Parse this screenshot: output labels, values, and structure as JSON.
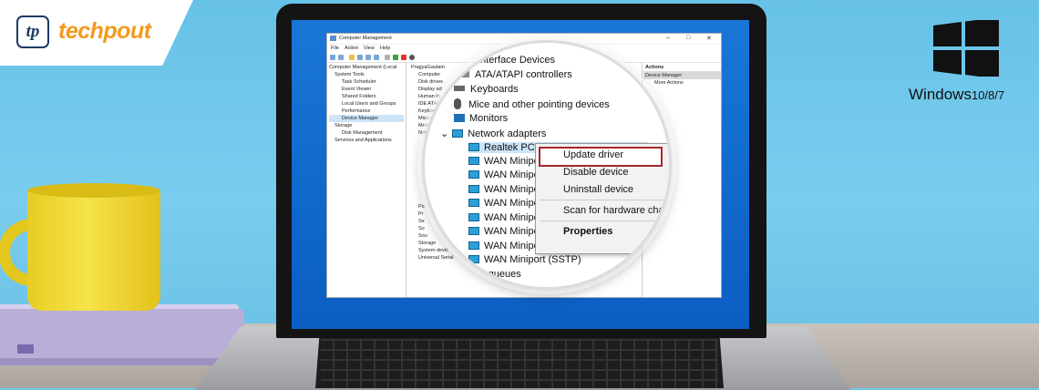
{
  "brand": {
    "logo_mark": "tp",
    "logo_text": "techpout"
  },
  "os_badge": {
    "name": "Windows",
    "versions": "10/8/7",
    "icon": "windows-logo-icon"
  },
  "window": {
    "title": "Computer Management",
    "controls": [
      "–",
      "□",
      "✕"
    ],
    "menu": [
      "File",
      "Action",
      "View",
      "Help"
    ],
    "left_tree": [
      "Computer Management (Local",
      "System Tools",
      "Task Scheduler",
      "Event Viewer",
      "Shared Folders",
      "Local Users and Groups",
      "Performance",
      "Device Manager",
      "Storage",
      "Disk Management",
      "Services and Applications"
    ],
    "middle_tree": [
      "PragyaGautam",
      "Computer",
      "Disk drives",
      "Display ad",
      "Human In",
      "IDE ATA/",
      "Keyboar",
      "Mice an",
      "Monito",
      "Netwo"
    ],
    "middle_tree_lower": [
      "Po",
      "Pr",
      "Se",
      "So",
      "Sou",
      "Storage",
      "System devic",
      "Universal Serial"
    ],
    "actions": {
      "header": "Actions",
      "item": "Device Manager",
      "more": "More Actions"
    }
  },
  "magnifier": {
    "rows": [
      "Interface Devices",
      "ATA/ATAPI controllers",
      "Keyboards",
      "Mice and other pointing devices",
      "Monitors",
      "Network adapters",
      "Realtek PCIe GbE Family Controller",
      "WAN Minipo",
      "WAN Minipo",
      "WAN Minipo",
      "WAN Minipo",
      "WAN Minipo",
      "WAN Minipo",
      "WAN Minipo",
      "WAN Miniport (SSTP)",
      "Print queues"
    ],
    "context_menu": {
      "update": "Update driver",
      "disable": "Disable device",
      "uninstall": "Uninstall device",
      "scan": "Scan for hardware char",
      "properties": "Properties"
    }
  }
}
